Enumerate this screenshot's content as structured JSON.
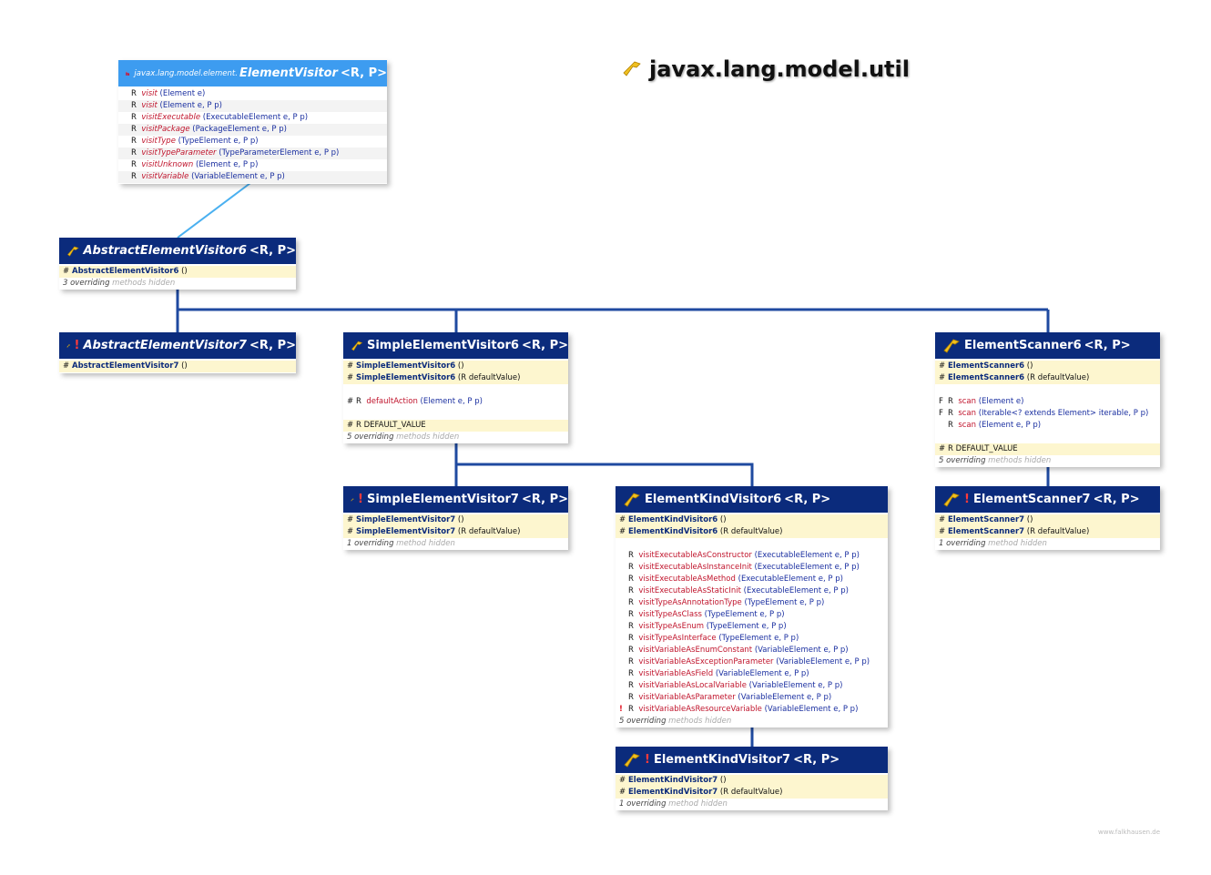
{
  "package_title": "javax.lang.model.util",
  "watermark": "www.falkhausen.de",
  "interface_box": {
    "package_prefix": "javax.lang.model.element.",
    "name": "ElementVisitor",
    "generics": "<R, P>",
    "methods": [
      {
        "ret": "R",
        "name": "visit",
        "params": "(Element e)"
      },
      {
        "ret": "R",
        "name": "visit",
        "params": "(Element e, P p)"
      },
      {
        "ret": "R",
        "name": "visitExecutable",
        "params": "(ExecutableElement e, P p)"
      },
      {
        "ret": "R",
        "name": "visitPackage",
        "params": "(PackageElement e, P p)"
      },
      {
        "ret": "R",
        "name": "visitType",
        "params": "(TypeElement e, P p)"
      },
      {
        "ret": "R",
        "name": "visitTypeParameter",
        "params": "(TypeParameterElement e, P p)"
      },
      {
        "ret": "R",
        "name": "visitUnknown",
        "params": "(Element e, P p)"
      },
      {
        "ret": "R",
        "name": "visitVariable",
        "params": "(VariableElement e, P p)"
      }
    ]
  },
  "aev6": {
    "name": "AbstractElementVisitor6",
    "generics": "<R, P>",
    "ctor": {
      "mod": "#",
      "name": "AbstractElementVisitor6",
      "params": "()"
    },
    "note_count": "3 overriding",
    "note_rest": "methods hidden"
  },
  "aev7": {
    "warn": "!",
    "name": "AbstractElementVisitor7",
    "generics": "<R, P>",
    "ctor": {
      "mod": "#",
      "name": "AbstractElementVisitor7",
      "params": "()"
    }
  },
  "sev6": {
    "name": "SimpleElementVisitor6",
    "generics": "<R, P>",
    "ctors": [
      {
        "mod": "#",
        "name": "SimpleElementVisitor6",
        "params": "()"
      },
      {
        "mod": "#",
        "name": "SimpleElementVisitor6",
        "params": "(R defaultValue)"
      }
    ],
    "method": {
      "mod": "#",
      "ret": "R",
      "name": "defaultAction",
      "params": "(Element e, P p)"
    },
    "field": {
      "mod": "#",
      "ret": "R",
      "name": "DEFAULT_VALUE"
    },
    "note_count": "5 overriding",
    "note_rest": "methods hidden"
  },
  "es6": {
    "name": "ElementScanner6",
    "generics": "<R, P>",
    "ctors": [
      {
        "mod": "#",
        "name": "ElementScanner6",
        "params": "()"
      },
      {
        "mod": "#",
        "name": "ElementScanner6",
        "params": "(R defaultValue)"
      }
    ],
    "methods": [
      {
        "mod": "F",
        "ret": "R",
        "name": "scan",
        "params": "(Element e)"
      },
      {
        "mod": "F",
        "ret": "R",
        "name": "scan",
        "params": "(Iterable<? extends Element> iterable, P p)"
      },
      {
        "mod": "",
        "ret": "R",
        "name": "scan",
        "params": "(Element e, P p)"
      }
    ],
    "field": {
      "mod": "#",
      "ret": "R",
      "name": "DEFAULT_VALUE"
    },
    "note_count": "5 overriding",
    "note_rest": "methods hidden"
  },
  "sev7": {
    "warn": "!",
    "name": "SimpleElementVisitor7",
    "generics": "<R, P>",
    "ctors": [
      {
        "mod": "#",
        "name": "SimpleElementVisitor7",
        "params": "()"
      },
      {
        "mod": "#",
        "name": "SimpleElementVisitor7",
        "params": "(R defaultValue)"
      }
    ],
    "note_count": "1 overriding",
    "note_rest": "method hidden"
  },
  "ekv6": {
    "name": "ElementKindVisitor6",
    "generics": "<R, P>",
    "ctors": [
      {
        "mod": "#",
        "name": "ElementKindVisitor6",
        "params": "()"
      },
      {
        "mod": "#",
        "name": "ElementKindVisitor6",
        "params": "(R defaultValue)"
      }
    ],
    "methods": [
      {
        "mod": "",
        "ret": "R",
        "name": "visitExecutableAsConstructor",
        "params": "(ExecutableElement e, P p)"
      },
      {
        "mod": "",
        "ret": "R",
        "name": "visitExecutableAsInstanceInit",
        "params": "(ExecutableElement e, P p)"
      },
      {
        "mod": "",
        "ret": "R",
        "name": "visitExecutableAsMethod",
        "params": "(ExecutableElement e, P p)"
      },
      {
        "mod": "",
        "ret": "R",
        "name": "visitExecutableAsStaticInit",
        "params": "(ExecutableElement e, P p)"
      },
      {
        "mod": "",
        "ret": "R",
        "name": "visitTypeAsAnnotationType",
        "params": "(TypeElement e, P p)"
      },
      {
        "mod": "",
        "ret": "R",
        "name": "visitTypeAsClass",
        "params": "(TypeElement e, P p)"
      },
      {
        "mod": "",
        "ret": "R",
        "name": "visitTypeAsEnum",
        "params": "(TypeElement e, P p)"
      },
      {
        "mod": "",
        "ret": "R",
        "name": "visitTypeAsInterface",
        "params": "(TypeElement e, P p)"
      },
      {
        "mod": "",
        "ret": "R",
        "name": "visitVariableAsEnumConstant",
        "params": "(VariableElement e, P p)"
      },
      {
        "mod": "",
        "ret": "R",
        "name": "visitVariableAsExceptionParameter",
        "params": "(VariableElement e, P p)"
      },
      {
        "mod": "",
        "ret": "R",
        "name": "visitVariableAsField",
        "params": "(VariableElement e, P p)"
      },
      {
        "mod": "",
        "ret": "R",
        "name": "visitVariableAsLocalVariable",
        "params": "(VariableElement e, P p)"
      },
      {
        "mod": "",
        "ret": "R",
        "name": "visitVariableAsParameter",
        "params": "(VariableElement e, P p)"
      },
      {
        "mod": "!",
        "ret": "R",
        "name": "visitVariableAsResourceVariable",
        "params": "(VariableElement e, P p)"
      }
    ],
    "note_count": "5 overriding",
    "note_rest": "methods hidden"
  },
  "es7": {
    "warn": "!",
    "name": "ElementScanner7",
    "generics": "<R, P>",
    "ctors": [
      {
        "mod": "#",
        "name": "ElementScanner7",
        "params": "()"
      },
      {
        "mod": "#",
        "name": "ElementScanner7",
        "params": "(R defaultValue)"
      }
    ],
    "note_count": "1 overriding",
    "note_rest": "method hidden"
  },
  "ekv7": {
    "warn": "!",
    "name": "ElementKindVisitor7",
    "generics": "<R, P>",
    "ctors": [
      {
        "mod": "#",
        "name": "ElementKindVisitor7",
        "params": "()"
      },
      {
        "mod": "#",
        "name": "ElementKindVisitor7",
        "params": "(R defaultValue)"
      }
    ],
    "note_count": "1 overriding",
    "note_rest": "method hidden"
  },
  "colors": {
    "header": "#0b2b7c",
    "interface_header": "#3d9cf0",
    "method": "#c0142c",
    "type": "#1a2fa0",
    "ctor_row": "#fdf6cf",
    "line": "#1f4aa0",
    "impl_line": "#4ab0f0"
  }
}
